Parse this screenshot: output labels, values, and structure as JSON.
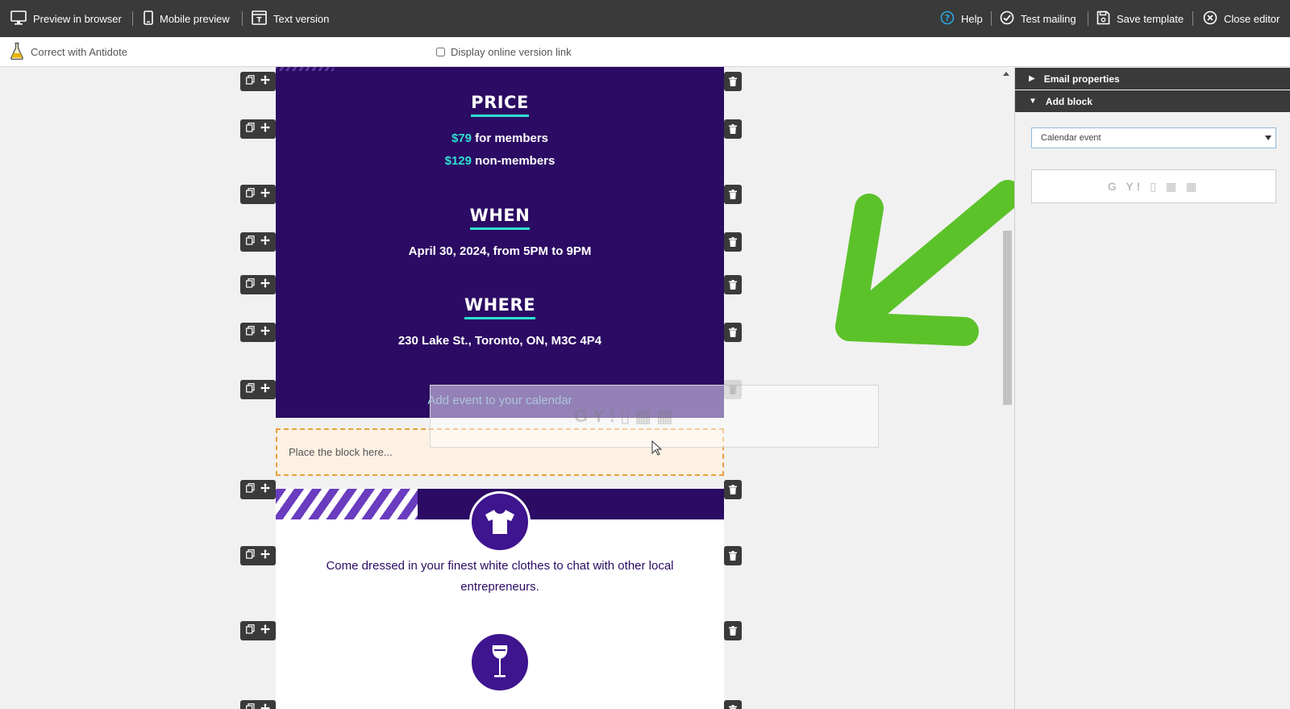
{
  "toolbar": {
    "preview_browser": "Preview in browser",
    "mobile_preview": "Mobile preview",
    "text_version": "Text version",
    "help": "Help",
    "test_mailing": "Test mailing",
    "save_template": "Save template",
    "close_editor": "Close editor"
  },
  "subbar": {
    "antidote": "Correct with Antidote",
    "online_link": "Display online version link"
  },
  "email": {
    "price_heading": "PRICE",
    "price_members_amount": "$79",
    "price_members_text": "for members",
    "price_nonmembers_amount": "$129",
    "price_nonmembers_text": "non-members",
    "when_heading": "WHEN",
    "when_text": "April 30, 2024, from 5PM to 9PM",
    "where_heading": "WHERE",
    "where_text": "230 Lake St., Toronto, ON, M3C 4P4",
    "add_calendar": "Add event to your calendar",
    "placeholder": "Place the block here...",
    "dress_text": "Come dressed in your finest white clothes to chat with other local entrepreneurs."
  },
  "panel": {
    "email_properties": "Email properties",
    "add_block": "Add block",
    "block_type_selected": "Calendar event"
  },
  "colors": {
    "email_purple": "#2b0b63",
    "accent_teal": "#2ee0d0",
    "arrow_green": "#5cc22a",
    "toolbar_dark": "#3a3a3a"
  },
  "icons": {
    "calendar_providers": [
      "apple-icon",
      "google-icon",
      "yahoo-icon",
      "office-icon",
      "outlook-icon",
      "outlook-web-icon"
    ]
  }
}
